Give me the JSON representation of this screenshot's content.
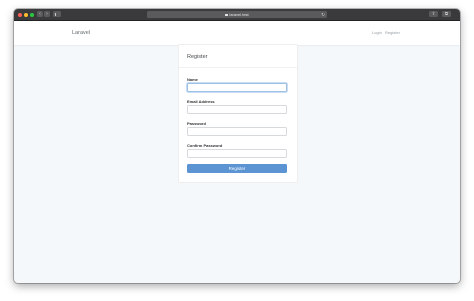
{
  "browser": {
    "address": "laravel.test",
    "icons": {
      "back": "chevron-left-icon",
      "forward": "chevron-right-icon",
      "reload": "reload-icon",
      "lock": "lock-icon",
      "share": "share-icon",
      "tabs": "tabs-icon"
    }
  },
  "navbar": {
    "brand": "Laravel",
    "login": "Login",
    "register": "Register"
  },
  "form": {
    "title": "Register",
    "name_label": "Name",
    "name_value": "",
    "email_label": "Email Address",
    "email_value": "",
    "password_label": "Password",
    "password_value": "",
    "confirm_label": "Confirm Password",
    "confirm_value": "",
    "submit_label": "Register"
  },
  "colors": {
    "page_background": "#f5f8fa",
    "primary_button": "#5b93d3",
    "focus_ring": "#9cc3e6"
  }
}
